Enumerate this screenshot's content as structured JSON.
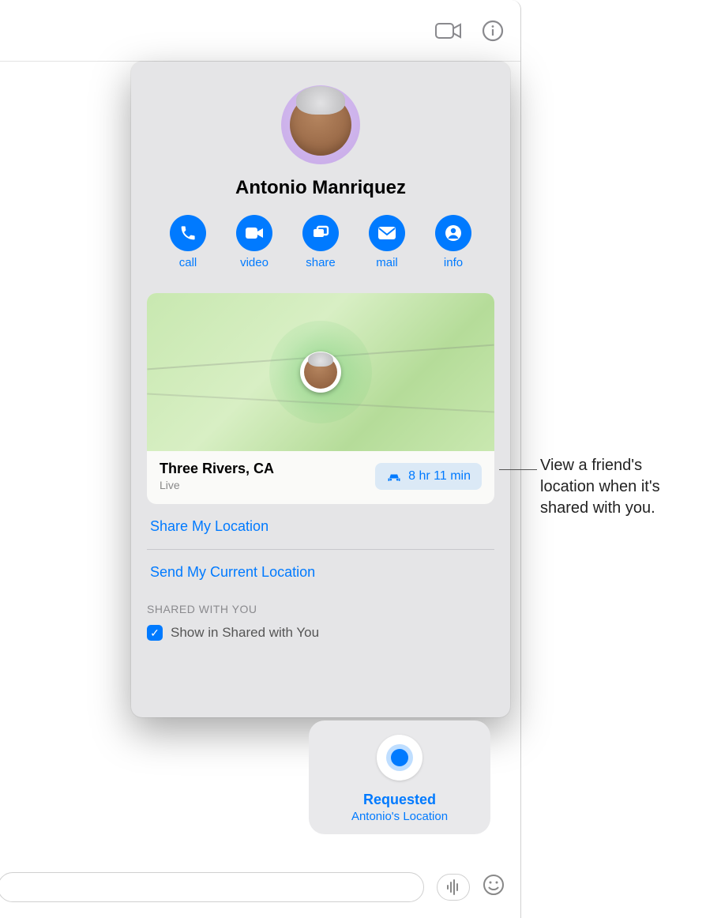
{
  "contact": {
    "name": "Antonio Manriquez"
  },
  "actions": {
    "call": "call",
    "video": "video",
    "share": "share",
    "mail": "mail",
    "info": "info"
  },
  "location": {
    "place": "Three Rivers, CA",
    "status": "Live",
    "eta": "8 hr 11 min"
  },
  "links": {
    "share_my_location": "Share My Location",
    "send_current_location": "Send My Current Location"
  },
  "shared_with_you": {
    "header": "SHARED WITH YOU",
    "show_label": "Show in Shared with You",
    "checked": true
  },
  "message_bubble": {
    "title": "Requested",
    "subtitle": "Antonio's Location"
  },
  "callout": {
    "text": "View a friend's location when it's shared with you."
  }
}
